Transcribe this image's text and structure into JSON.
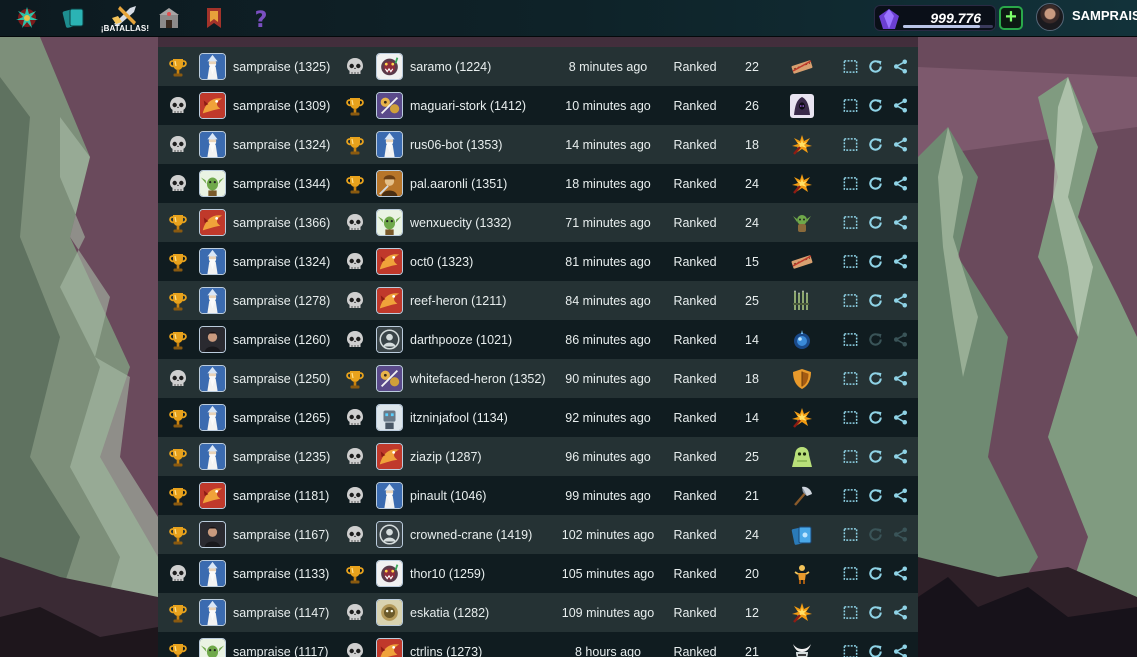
{
  "topbar": {
    "nav": [
      {
        "name": "dragon-emblem-icon"
      },
      {
        "name": "cards-icon"
      },
      {
        "name": "battles-icon",
        "label": "¡BATALLAS!"
      },
      {
        "name": "guild-icon"
      },
      {
        "name": "tournament-banner-icon"
      },
      {
        "name": "help-icon"
      }
    ],
    "credits": "999.776",
    "credits_progress": 0.85,
    "add_label": "+",
    "username": "SAMPRAIS"
  },
  "rows": [
    {
      "p1_result": "win",
      "p1_avatar": "wizard",
      "p1": "sampraise (1325)",
      "p2_result": "loss",
      "p2_avatar": "monster",
      "p2": "saramo (1224)",
      "time": "8 minutes ago",
      "mode": "Ranked",
      "mana": "22",
      "ruleset": "broken-arrows",
      "replay_enabled": true
    },
    {
      "p1_result": "loss",
      "p1_avatar": "dragon",
      "p1": "sampraise (1309)",
      "p2_result": "win",
      "p2_avatar": "stork",
      "p2": "maguari-stork (1412)",
      "time": "10 minutes ago",
      "mode": "Ranked",
      "mana": "26",
      "ruleset": "hooded-figure",
      "replay_enabled": true
    },
    {
      "p1_result": "loss",
      "p1_avatar": "wizard",
      "p1": "sampraise (1324)",
      "p2_result": "win",
      "p2_avatar": "wizard",
      "p2": "rus06-bot (1353)",
      "time": "14 minutes ago",
      "mode": "Ranked",
      "mana": "18",
      "ruleset": "explosion",
      "replay_enabled": true
    },
    {
      "p1_result": "loss",
      "p1_avatar": "goblin",
      "p1": "sampraise (1344)",
      "p2_result": "win",
      "p2_avatar": "warrior",
      "p2": "pal.aaronli (1351)",
      "time": "18 minutes ago",
      "mode": "Ranked",
      "mana": "24",
      "ruleset": "explosion",
      "replay_enabled": true
    },
    {
      "p1_result": "win",
      "p1_avatar": "dragon",
      "p1": "sampraise (1366)",
      "p2_result": "loss",
      "p2_avatar": "goblin",
      "p2": "wenxuecity (1332)",
      "time": "71 minutes ago",
      "mode": "Ranked",
      "mana": "24",
      "ruleset": "goblin-figure",
      "replay_enabled": true
    },
    {
      "p1_result": "win",
      "p1_avatar": "wizard",
      "p1": "sampraise (1324)",
      "p2_result": "loss",
      "p2_avatar": "dragon",
      "p2": "oct0 (1323)",
      "time": "81 minutes ago",
      "mode": "Ranked",
      "mana": "15",
      "ruleset": "broken-arrows",
      "replay_enabled": true
    },
    {
      "p1_result": "win",
      "p1_avatar": "wizard",
      "p1": "sampraise (1278)",
      "p2_result": "loss",
      "p2_avatar": "dragon",
      "p2": "reef-heron (1211)",
      "time": "84 minutes ago",
      "mode": "Ranked",
      "mana": "25",
      "ruleset": "spears",
      "replay_enabled": true
    },
    {
      "p1_result": "win",
      "p1_avatar": "human",
      "p1": "sampraise (1260)",
      "p2_result": "loss",
      "p2_avatar": "default",
      "p2": "darthpooze (1021)",
      "time": "86 minutes ago",
      "mode": "Ranked",
      "mana": "14",
      "ruleset": "blue-orb",
      "replay_enabled": false
    },
    {
      "p1_result": "loss",
      "p1_avatar": "wizard",
      "p1": "sampraise (1250)",
      "p2_result": "win",
      "p2_avatar": "stork",
      "p2": "whitefaced-heron (1352)",
      "time": "90 minutes ago",
      "mode": "Ranked",
      "mana": "18",
      "ruleset": "shield",
      "replay_enabled": true
    },
    {
      "p1_result": "win",
      "p1_avatar": "wizard",
      "p1": "sampraise (1265)",
      "p2_result": "loss",
      "p2_avatar": "robot",
      "p2": "itzninjafool (1134)",
      "time": "92 minutes ago",
      "mode": "Ranked",
      "mana": "14",
      "ruleset": "explosion",
      "replay_enabled": true
    },
    {
      "p1_result": "win",
      "p1_avatar": "wizard",
      "p1": "sampraise (1235)",
      "p2_result": "loss",
      "p2_avatar": "dragon",
      "p2": "ziazip (1287)",
      "time": "96 minutes ago",
      "mode": "Ranked",
      "mana": "25",
      "ruleset": "green-ghost",
      "replay_enabled": true
    },
    {
      "p1_result": "win",
      "p1_avatar": "dragon",
      "p1": "sampraise (1181)",
      "p2_result": "loss",
      "p2_avatar": "wizard",
      "p2": "pinault (1046)",
      "time": "99 minutes ago",
      "mode": "Ranked",
      "mana": "21",
      "ruleset": "axe",
      "replay_enabled": true
    },
    {
      "p1_result": "win",
      "p1_avatar": "human",
      "p1": "sampraise (1167)",
      "p2_result": "loss",
      "p2_avatar": "default",
      "p2": "crowned-crane (1419)",
      "time": "102 minutes ago",
      "mode": "Ranked",
      "mana": "24",
      "ruleset": "cards",
      "replay_enabled": false
    },
    {
      "p1_result": "loss",
      "p1_avatar": "wizard",
      "p1": "sampraise (1133)",
      "p2_result": "win",
      "p2_avatar": "monster",
      "p2": "thor10 (1259)",
      "time": "105 minutes ago",
      "mode": "Ranked",
      "mana": "20",
      "ruleset": "golden-figure",
      "replay_enabled": true
    },
    {
      "p1_result": "win",
      "p1_avatar": "wizard",
      "p1": "sampraise (1147)",
      "p2_result": "loss",
      "p2_avatar": "golem",
      "p2": "eskatia (1282)",
      "time": "109 minutes ago",
      "mode": "Ranked",
      "mana": "12",
      "ruleset": "explosion",
      "replay_enabled": true
    },
    {
      "p1_result": "win",
      "p1_avatar": "goblin",
      "p1": "sampraise (1117)",
      "p2_result": "loss",
      "p2_avatar": "dragon",
      "p2": "ctrlins (1273)",
      "time": "8 hours ago",
      "mode": "Ranked",
      "mana": "21",
      "ruleset": "horned-helm",
      "replay_enabled": true
    }
  ],
  "colors": {
    "row_odd": "#253234",
    "row_even": "#101c20",
    "trophy": "#e8a21c",
    "skull": "#c8c8c8",
    "action": "#8fd3e6"
  }
}
